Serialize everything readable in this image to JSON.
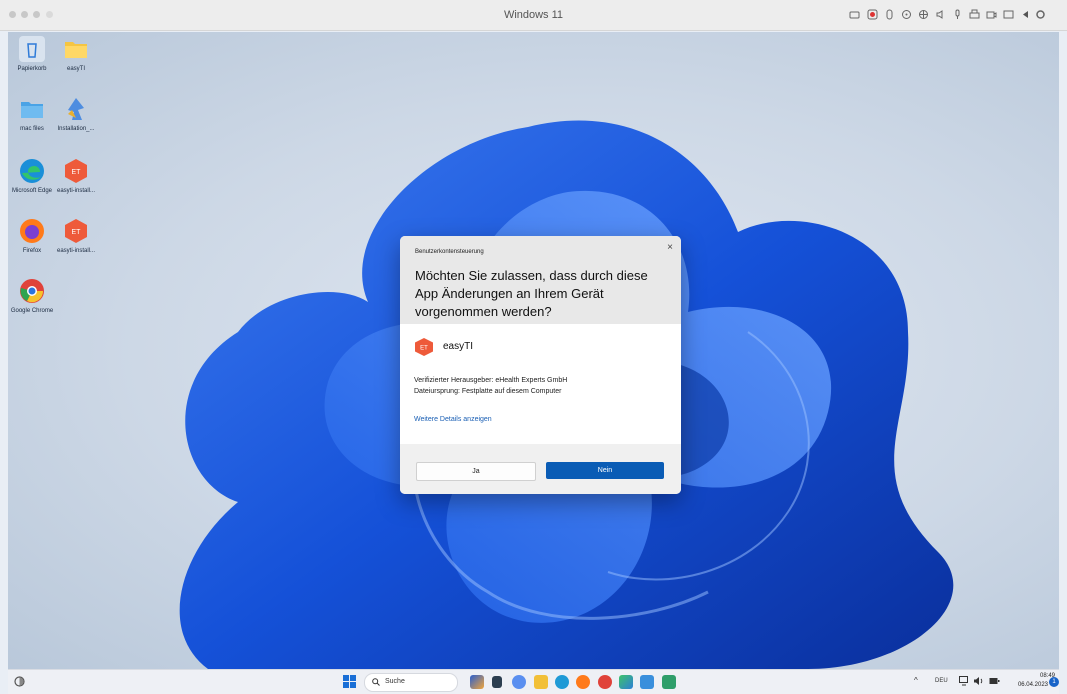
{
  "mac_window": {
    "title": "Windows 11"
  },
  "desktop_icons": [
    {
      "label": "Papierkorb",
      "icon": "recycle-bin-icon"
    },
    {
      "label": "easyTI",
      "icon": "folder-icon"
    },
    {
      "label": "mac files",
      "icon": "mac-files-icon"
    },
    {
      "label": "Installation_...",
      "icon": "installer-icon"
    },
    {
      "label": "Microsoft Edge",
      "icon": "edge-icon"
    },
    {
      "label": "easyti-install...",
      "icon": "easyti-installer-icon"
    },
    {
      "label": "Firefox",
      "icon": "firefox-icon"
    },
    {
      "label": "easyti-install...",
      "icon": "easyti-installer-icon"
    },
    {
      "label": "Google Chrome",
      "icon": "chrome-icon"
    }
  ],
  "uac": {
    "caption": "Benutzerkontensteuerung",
    "close": "×",
    "question": "Möchten Sie zulassen, dass durch diese App Änderungen an Ihrem Gerät vorgenommen werden?",
    "app_name": "easyTI",
    "app_icon_text": "ET",
    "publisher": "Verifizierter Herausgeber: eHealth Experts GmbH",
    "origin": "Dateiursprung: Festplatte auf diesem Computer",
    "details_link": "Weitere Details anzeigen",
    "yes": "Ja",
    "no": "Nein",
    "accent": "#0a5cb5"
  },
  "taskbar": {
    "search_placeholder": "Suche",
    "tray_chevron": "^",
    "language": "DEU",
    "time": "08:49",
    "date": "06.04.2023",
    "notifications": "1"
  }
}
